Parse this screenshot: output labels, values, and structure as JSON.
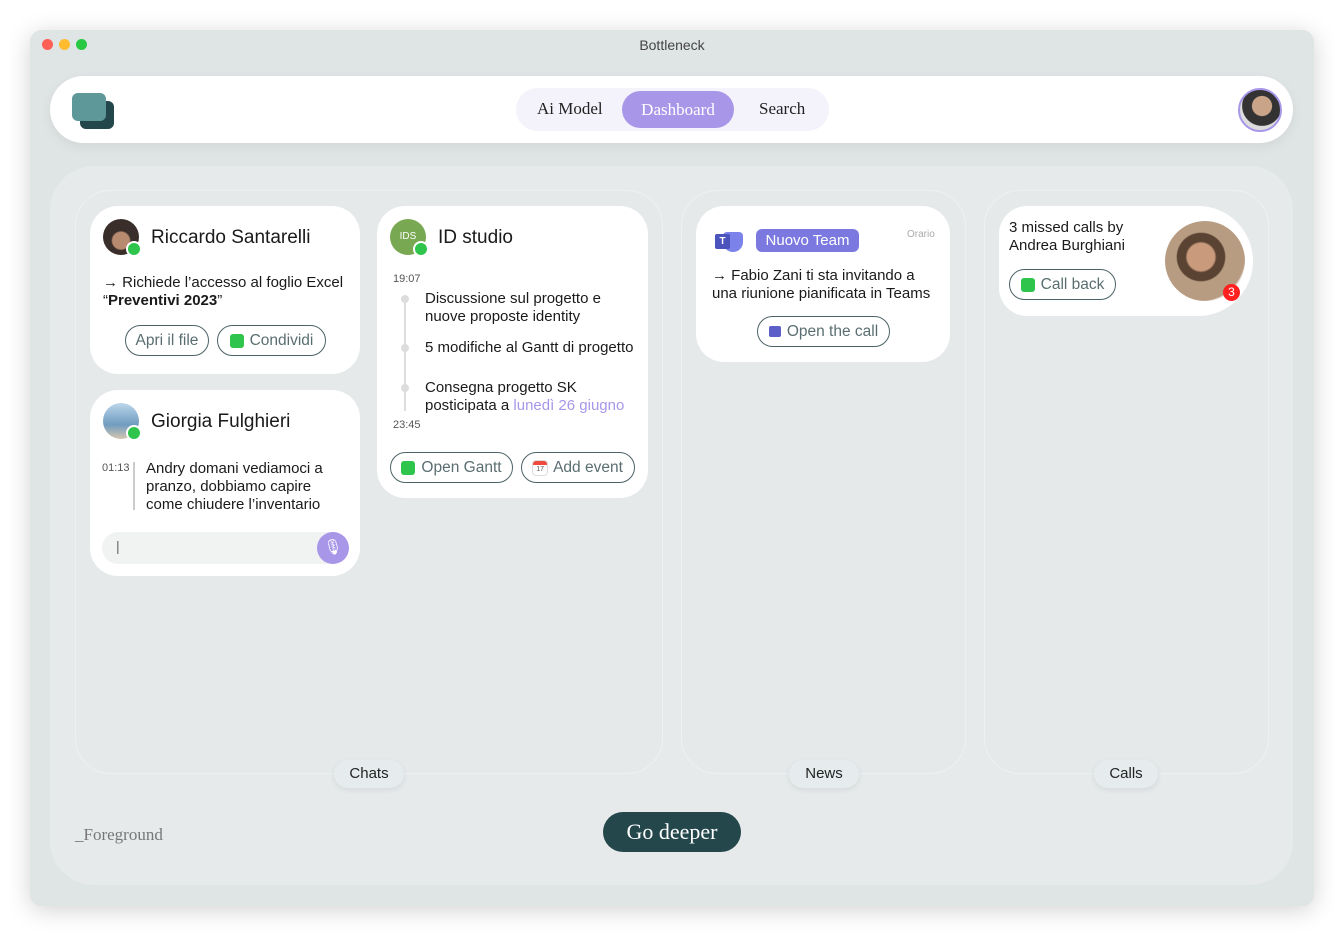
{
  "window": {
    "title": "Bottleneck"
  },
  "header": {
    "nav": [
      {
        "label": "Ai Model"
      },
      {
        "label": "Dashboard",
        "active": true
      },
      {
        "label": "Search"
      }
    ]
  },
  "chats": {
    "label": "Chats",
    "riccardo": {
      "name": "Riccardo Santarelli",
      "message_prefix": "→ Richiede l’accesso al foglio Excel",
      "message_quote_open": "“",
      "message_bold": "Preventivi 2023",
      "message_quote_close": "”",
      "buttons": [
        "Apri il file",
        "Condividi"
      ]
    },
    "giorgia": {
      "name": "Giorgia Fulghieri",
      "time": "01:13",
      "message": "Andry domani vediamoci a pranzo, dobbiamo capire come chiudere l’inventario",
      "input_value": "|"
    },
    "idstudio": {
      "name": "ID studio",
      "avatar_text": "IDS",
      "start_time": "19:07",
      "end_time": "23:45",
      "items": [
        "Discussione sul progetto e nuove proposte identity",
        "5 modifiche al Gantt di progetto"
      ],
      "last_item_prefix": "Consegna progetto SK posticipata a ",
      "last_item_highlight": "lunedì 26 giugno",
      "buttons": [
        "Open Gantt",
        "Add event"
      ],
      "calendar_day": "17"
    }
  },
  "news": {
    "label": "News",
    "teams": {
      "tag": "Nuovo Team",
      "meta": "Orario",
      "message": "→ Fabio Zani ti sta invitando a una riunione pianificata in Teams",
      "button": "Open the call"
    }
  },
  "calls": {
    "label": "Calls",
    "missed": {
      "line1": "3 missed calls by",
      "line2": "Andrea Burghiani",
      "button": "Call back",
      "badge_count": "3"
    }
  },
  "footer": {
    "foreground_label": "_Foreground",
    "go_deeper": "Go deeper"
  },
  "colors": {
    "accent": "#a897e8",
    "dark": "#24474c",
    "whatsapp": "#2fc54c",
    "teams": "#6c6fd6",
    "badge": "#ff2020"
  }
}
